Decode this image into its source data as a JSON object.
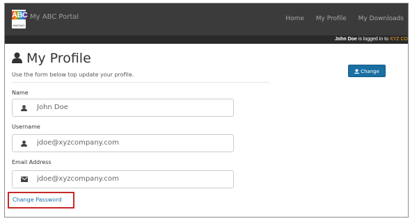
{
  "header": {
    "logo_text": "ABC",
    "logo_subtext": "IMAGING",
    "title": "My ABC Portal",
    "nav": [
      "Home",
      "My Profile",
      "My Downloads"
    ]
  },
  "infobar": {
    "user": "John Doe",
    "text": "is logged in to",
    "company": "XYZ CO"
  },
  "page": {
    "title": "My Profile",
    "subtitle": "Use the form below top update your profile.",
    "change_button": "Change"
  },
  "form": {
    "name_label": "Name",
    "name_value": "John Doe",
    "username_label": "Username",
    "username_value": "jdoe@xyzcompany.com",
    "email_label": "Email Address",
    "email_value": "jdoe@xyzcompany.com",
    "change_password": "Change Password"
  },
  "colors": {
    "navbar": "#3b3b3b",
    "accent": "#1a6fa3",
    "highlight": "#c62828",
    "company": "#f5a623"
  },
  "icons": {
    "title": "user-icon",
    "name": "user-icon",
    "username": "user-icon",
    "email": "envelope-icon",
    "change": "upload-icon"
  }
}
